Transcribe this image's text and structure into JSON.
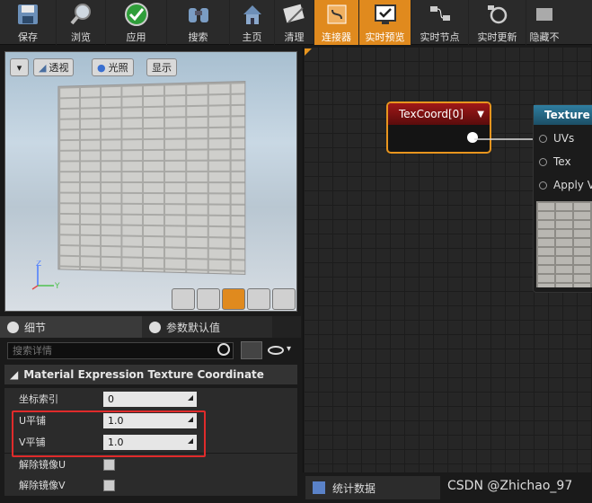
{
  "toolbar": {
    "save": "保存",
    "browse": "浏览",
    "apply": "应用",
    "search": "搜索",
    "home": "主页",
    "clean": "清理",
    "connector": "连接器",
    "live_preview": "实时预览",
    "live_nodes": "实时节点",
    "live_update": "实时更新",
    "hide": "隐藏不"
  },
  "viewport": {
    "perspective": "透视",
    "lit": "光照",
    "show": "显示"
  },
  "panel": {
    "tab_details": "细节",
    "tab_defaults": "参数默认值",
    "search_placeholder": "搜索详情",
    "category": "Material Expression Texture Coordinate",
    "rows": [
      {
        "label": "坐标索引",
        "value": "0"
      },
      {
        "label": "U平铺",
        "value": "1.0"
      },
      {
        "label": "V平铺",
        "value": "1.0"
      },
      {
        "label": "解除镜像U"
      },
      {
        "label": "解除镜像V"
      }
    ]
  },
  "graph": {
    "node1_title": "TexCoord[0]",
    "node2_title": "Texture Sa",
    "pins": [
      "UVs",
      "Tex",
      "Apply V"
    ]
  },
  "stats_tab": "统计数据",
  "watermark": "CSDN @Zhichao_97"
}
